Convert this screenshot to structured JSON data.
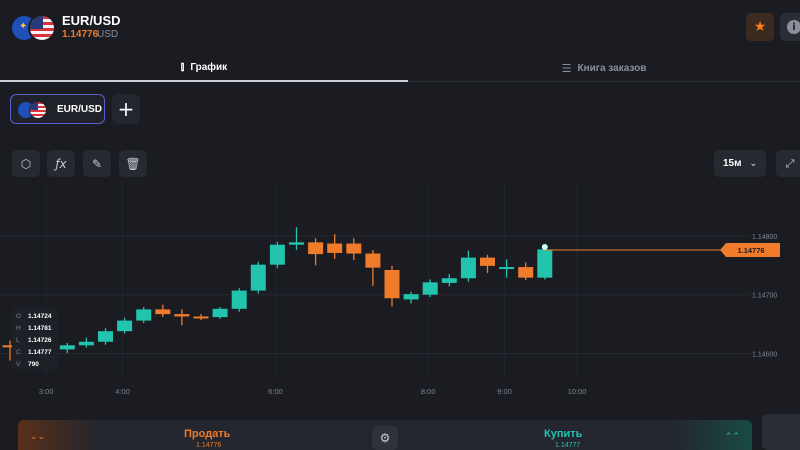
{
  "header": {
    "pair": "EUR/USD",
    "price": "1.14776",
    "currency": "USD"
  },
  "tabs": [
    {
      "label": "График",
      "icon": "candles-icon",
      "active": true
    },
    {
      "label": "Книга заказов",
      "icon": "order-book-icon",
      "active": false
    }
  ],
  "asset_chip": {
    "label": "EUR/USD"
  },
  "toolbar": {
    "tools": [
      "indicators-icon",
      "function-icon",
      "draw-icon",
      "trash-icon"
    ],
    "interval": "15м"
  },
  "ohlc": [
    {
      "key": "O",
      "value": "1.14724"
    },
    {
      "key": "H",
      "value": "1.14781"
    },
    {
      "key": "L",
      "value": "1.14726"
    },
    {
      "key": "C",
      "value": "1.14777"
    },
    {
      "key": "V",
      "value": "790"
    }
  ],
  "trade": {
    "sell_label": "Продать",
    "sell_price": "1.14776",
    "buy_label": "Купить",
    "buy_price": "1.14777"
  },
  "colors": {
    "up": "#22c4ae",
    "down": "#f07b2a",
    "accent_border": "#5a5fd1"
  },
  "chart_data": {
    "type": "candlestick",
    "x_tick_labels": [
      "3:00",
      "4:00",
      "6:00",
      "8:00",
      "9:00",
      "10:00"
    ],
    "y_tick_labels": [
      "1.14800",
      "1.14700",
      "1.14600"
    ],
    "ylim": [
      1.14555,
      1.14895
    ],
    "current_price_label": "1.14776",
    "current_price": 1.14776,
    "candles": [
      {
        "o": 1.14614,
        "h": 1.14622,
        "l": 1.14588,
        "c": 1.14612
      },
      {
        "o": 1.1462,
        "h": 1.14623,
        "l": 1.14598,
        "c": 1.14602
      },
      {
        "o": 1.14603,
        "h": 1.1461,
        "l": 1.14597,
        "c": 1.14608
      },
      {
        "o": 1.14607,
        "h": 1.14618,
        "l": 1.14601,
        "c": 1.14614
      },
      {
        "o": 1.14614,
        "h": 1.14627,
        "l": 1.1461,
        "c": 1.1462
      },
      {
        "o": 1.1462,
        "h": 1.14643,
        "l": 1.14615,
        "c": 1.14638
      },
      {
        "o": 1.14638,
        "h": 1.14661,
        "l": 1.14634,
        "c": 1.14656
      },
      {
        "o": 1.14656,
        "h": 1.14679,
        "l": 1.14652,
        "c": 1.14675
      },
      {
        "o": 1.14675,
        "h": 1.14683,
        "l": 1.14662,
        "c": 1.14667
      },
      {
        "o": 1.14667,
        "h": 1.14675,
        "l": 1.14648,
        "c": 1.14663
      },
      {
        "o": 1.14663,
        "h": 1.14667,
        "l": 1.14657,
        "c": 1.14662
      },
      {
        "o": 1.14662,
        "h": 1.14679,
        "l": 1.14659,
        "c": 1.14676
      },
      {
        "o": 1.14676,
        "h": 1.14711,
        "l": 1.14671,
        "c": 1.14707
      },
      {
        "o": 1.14707,
        "h": 1.14756,
        "l": 1.14702,
        "c": 1.14751
      },
      {
        "o": 1.14751,
        "h": 1.1479,
        "l": 1.14745,
        "c": 1.14785
      },
      {
        "o": 1.14785,
        "h": 1.14815,
        "l": 1.14776,
        "c": 1.14789
      },
      {
        "o": 1.14789,
        "h": 1.14796,
        "l": 1.1475,
        "c": 1.14769
      },
      {
        "o": 1.14787,
        "h": 1.14803,
        "l": 1.14761,
        "c": 1.14771
      },
      {
        "o": 1.14787,
        "h": 1.14796,
        "l": 1.14759,
        "c": 1.1477
      },
      {
        "o": 1.1477,
        "h": 1.14776,
        "l": 1.14715,
        "c": 1.14746
      },
      {
        "o": 1.14742,
        "h": 1.14749,
        "l": 1.1468,
        "c": 1.14694
      },
      {
        "o": 1.14692,
        "h": 1.14705,
        "l": 1.14685,
        "c": 1.14701
      },
      {
        "o": 1.147,
        "h": 1.14726,
        "l": 1.14696,
        "c": 1.14721
      },
      {
        "o": 1.1472,
        "h": 1.14735,
        "l": 1.14714,
        "c": 1.14728
      },
      {
        "o": 1.14728,
        "h": 1.14775,
        "l": 1.14722,
        "c": 1.14763
      },
      {
        "o": 1.14763,
        "h": 1.14768,
        "l": 1.14737,
        "c": 1.14749
      },
      {
        "o": 1.14747,
        "h": 1.1476,
        "l": 1.14729,
        "c": 1.14747
      },
      {
        "o": 1.14747,
        "h": 1.14755,
        "l": 1.14725,
        "c": 1.14729
      },
      {
        "o": 1.14729,
        "h": 1.14781,
        "l": 1.14726,
        "c": 1.14777
      }
    ]
  }
}
